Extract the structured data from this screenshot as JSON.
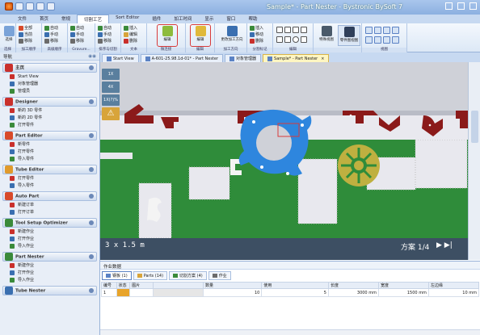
{
  "window": {
    "title": "Sample* - Part Nester - Bystronic BySoft 7"
  },
  "menu_tabs": [
    "文件",
    "首页",
    "常规",
    "切割工艺",
    "Sort Editor",
    "插件",
    "加工时间",
    "显示",
    "窗口",
    "帮助"
  ],
  "active_menu_tab": "切割工艺",
  "ribbon": {
    "groups": [
      "选择",
      "加工顺序",
      "高级顺序",
      "Gravure...",
      "排序与切割",
      "文本",
      "微连接",
      "编辑",
      "加工方向",
      "分割标记",
      "编辑",
      "视图"
    ],
    "items": {
      "select": "选择",
      "rows": [
        [
          "全部",
          "自动",
          "自动",
          "自动",
          "插入"
        ],
        [
          "当前",
          "手动",
          "手动",
          "手动",
          "编辑"
        ],
        [
          "移除",
          "移除",
          "移除",
          "移除",
          "删除"
        ]
      ],
      "edit1": "编辑",
      "edit2": "编辑",
      "change_dir": "更改加工方向",
      "insert": "插入",
      "move": "移动",
      "delete": "删除",
      "edit_part_view": "特殊视图",
      "part_view": "零件图视图"
    }
  },
  "sidebar": {
    "title": "导航",
    "panels": [
      {
        "name": "主页",
        "color": "#c9302c",
        "items": [
          "Start View",
          "对象管理器",
          "管理员"
        ]
      },
      {
        "name": "Designer",
        "color": "#c9302c",
        "items": [
          "新的 3D 零件",
          "新的 2D 零件",
          "打开零件"
        ]
      },
      {
        "name": "Part Editor",
        "color": "#d84a2a",
        "items": [
          "新零件",
          "打开零件",
          "导入零件"
        ]
      },
      {
        "name": "Tube Editor",
        "color": "#e09a2c",
        "items": [
          "打开零件",
          "导入零件"
        ]
      },
      {
        "name": "Auto Part",
        "color": "#d84a2a",
        "items": [
          "新建订单",
          "打开订单"
        ]
      },
      {
        "name": "Tool Setup Optimizer",
        "color": "#3a8a3a",
        "items": [
          "新建作业",
          "打开作业",
          "导入作业"
        ]
      },
      {
        "name": "Part Nester",
        "color": "#3a8a3a",
        "items": [
          "新建作业",
          "打开作业",
          "导入作业"
        ]
      },
      {
        "name": "Tube Nester",
        "color": "#3a6fb0",
        "items": []
      }
    ]
  },
  "doc_tabs": [
    {
      "label": "Start View",
      "active": false
    },
    {
      "label": "A-601-25.98.1d-01* - Part Nester",
      "active": false
    },
    {
      "label": "对象管理器",
      "active": false
    },
    {
      "label": "Sample* - Part Nester",
      "active": true
    }
  ],
  "canvas": {
    "zoom_buttons": [
      "1X",
      "4X",
      "1X(?)%"
    ],
    "scale_label": "3 x 1.5 m",
    "plan_label": "方案 1/4",
    "colors": {
      "sheet": "#2f8c3a",
      "part_blue": "#2e86de",
      "part_red": "#8b1a1a",
      "part_gear": "#bfb040",
      "bar": "#3d4f63"
    }
  },
  "jobs": {
    "title": "作业数据",
    "tabs": [
      {
        "label": "钢板 (1)",
        "active": true
      },
      {
        "label": "Parts (14)",
        "active": false
      },
      {
        "label": "切割方案 (4)",
        "active": false
      },
      {
        "label": "作业",
        "active": false
      }
    ],
    "columns": [
      "编号",
      "状态",
      "图片",
      "",
      "数量",
      "使用",
      "长度",
      "宽度",
      "左边缘"
    ],
    "rows": [
      [
        "1",
        "",
        "",
        "",
        "10",
        "5",
        "3000 mm",
        "1500 mm",
        "10 mm"
      ]
    ]
  }
}
